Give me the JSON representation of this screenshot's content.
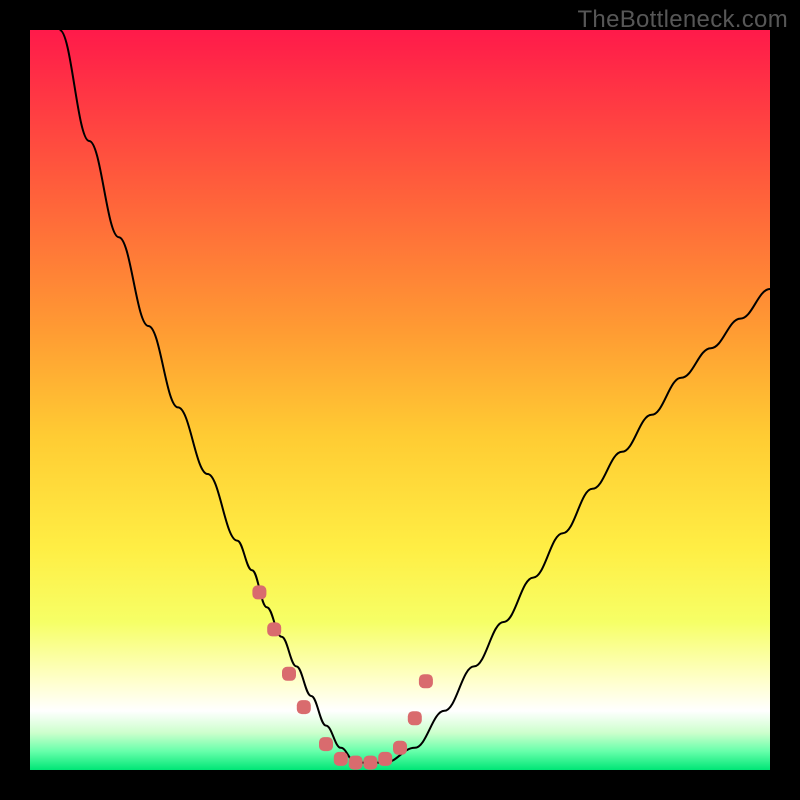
{
  "watermark": "TheBottleneck.com",
  "chart_data": {
    "type": "line",
    "title": "",
    "xlabel": "",
    "ylabel": "",
    "xlim": [
      0,
      100
    ],
    "ylim": [
      0,
      100
    ],
    "series": [
      {
        "name": "curve",
        "x": [
          4,
          8,
          12,
          16,
          20,
          24,
          28,
          30,
          32,
          34,
          36,
          38,
          40,
          42,
          44,
          48,
          52,
          56,
          60,
          64,
          68,
          72,
          76,
          80,
          84,
          88,
          92,
          96,
          100
        ],
        "y": [
          100,
          85,
          72,
          60,
          49,
          40,
          31,
          27,
          22,
          18,
          14,
          10,
          6,
          3,
          1,
          1,
          3,
          8,
          14,
          20,
          26,
          32,
          38,
          43,
          48,
          53,
          57,
          61,
          65
        ],
        "color": "#000000"
      }
    ],
    "highlight_points": {
      "name": "dots",
      "color": "#d96b6e",
      "x": [
        31,
        33,
        35,
        37,
        40,
        42,
        44,
        46,
        48,
        50,
        52,
        53.5
      ],
      "y": [
        24,
        19,
        13,
        8.5,
        3.5,
        1.5,
        1,
        1,
        1.5,
        3,
        7,
        12
      ]
    },
    "background_gradient": {
      "stops": [
        {
          "offset": 0.0,
          "color": "#ff1a4a"
        },
        {
          "offset": 0.2,
          "color": "#ff5a3c"
        },
        {
          "offset": 0.4,
          "color": "#ff9933"
        },
        {
          "offset": 0.55,
          "color": "#ffcc33"
        },
        {
          "offset": 0.7,
          "color": "#ffee44"
        },
        {
          "offset": 0.8,
          "color": "#f6ff66"
        },
        {
          "offset": 0.88,
          "color": "#ffffcc"
        },
        {
          "offset": 0.92,
          "color": "#ffffff"
        },
        {
          "offset": 0.95,
          "color": "#ccffcc"
        },
        {
          "offset": 0.975,
          "color": "#66ffaa"
        },
        {
          "offset": 1.0,
          "color": "#00e676"
        }
      ]
    }
  }
}
